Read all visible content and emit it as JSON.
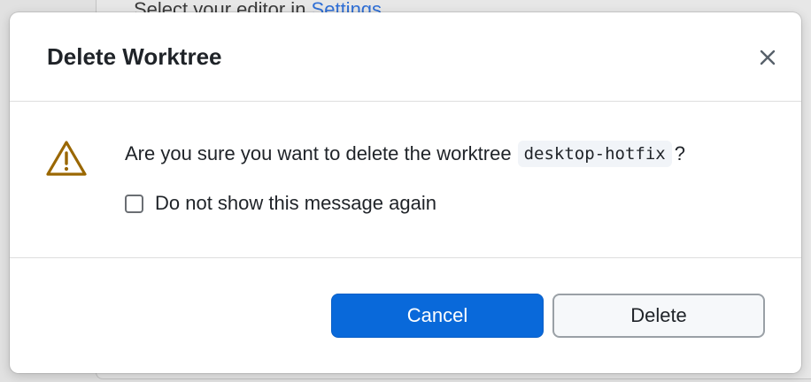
{
  "background": {
    "hint_text": "Select your editor in ",
    "hint_link": "Settings"
  },
  "dialog": {
    "title": "Delete Worktree",
    "close_icon": "close-icon",
    "warning_icon": "warning-triangle-icon",
    "message_before": "Are you sure you want to delete the worktree",
    "worktree_name": "desktop-hotfix",
    "message_after": "?",
    "checkbox_label": "Do not show this message again",
    "checkbox_checked": false,
    "cancel_label": "Cancel",
    "delete_label": "Delete"
  },
  "colors": {
    "primary_button": "#0969da",
    "warning": "#9a6700",
    "link": "#2f6fd6"
  }
}
